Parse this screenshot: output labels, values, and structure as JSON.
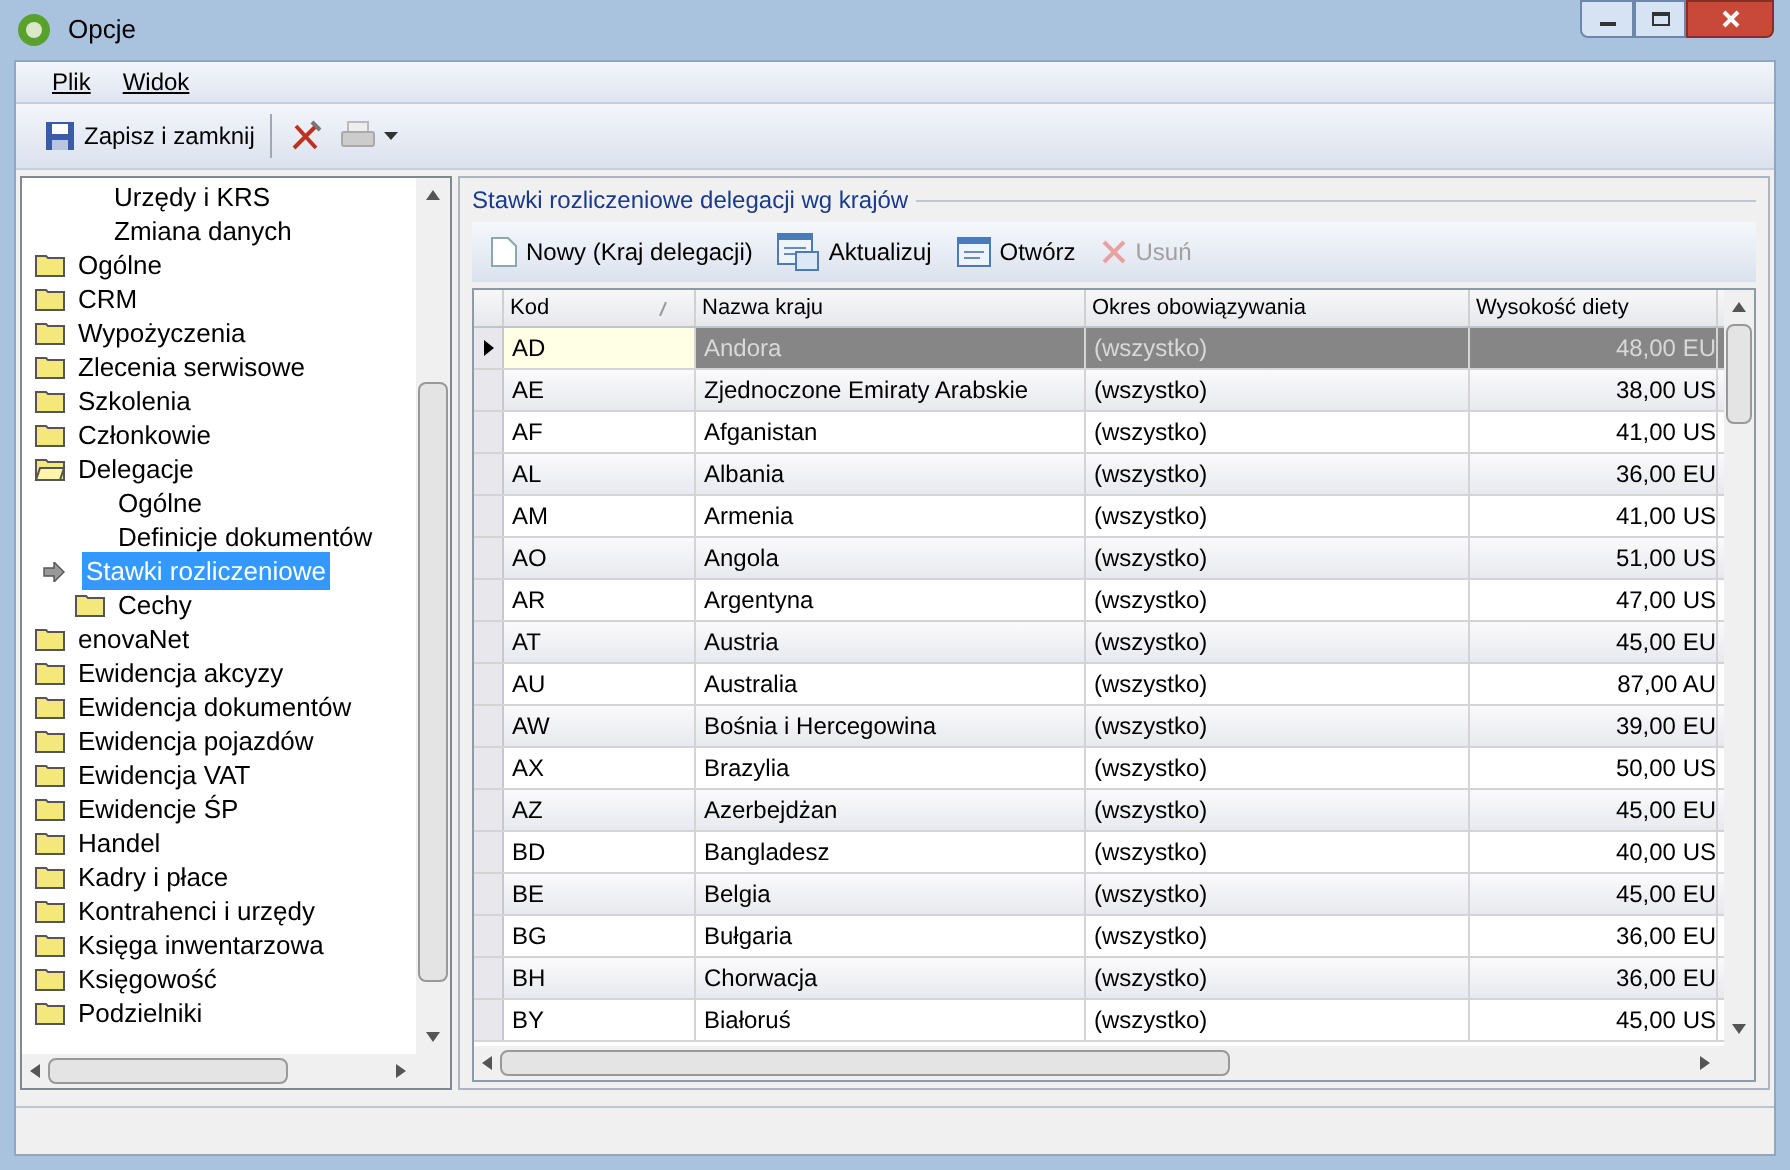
{
  "window": {
    "title": "Opcje"
  },
  "menu": [
    {
      "label": "Plik"
    },
    {
      "label": "Widok"
    }
  ],
  "toolbar": {
    "save_label": "Zapisz i zamknij"
  },
  "tree": {
    "partial_children": [
      {
        "label": "Urzędy i KRS"
      },
      {
        "label": "Zmiana danych"
      }
    ],
    "items": [
      {
        "label": "Ogólne",
        "kind": "folder",
        "expanded": false,
        "selected": false
      },
      {
        "label": "CRM",
        "kind": "folder",
        "expanded": false,
        "selected": false
      },
      {
        "label": "Wypożyczenia",
        "kind": "folder",
        "expanded": false,
        "selected": false
      },
      {
        "label": "Zlecenia serwisowe",
        "kind": "folder",
        "expanded": false,
        "selected": false
      },
      {
        "label": "Szkolenia",
        "kind": "folder",
        "expanded": false,
        "selected": false
      },
      {
        "label": "Członkowie",
        "kind": "folder",
        "expanded": false,
        "selected": false
      },
      {
        "label": "Delegacje",
        "kind": "folder",
        "expanded": true,
        "selected": false,
        "children": [
          {
            "label": "Ogólne",
            "kind": "leaf",
            "selected": false
          },
          {
            "label": "Definicje dokumentów",
            "kind": "leaf",
            "selected": false
          },
          {
            "label": "Stawki rozliczeniowe",
            "kind": "leaf",
            "selected": true
          },
          {
            "label": "Cechy",
            "kind": "folder",
            "expanded": false,
            "selected": false
          }
        ]
      },
      {
        "label": "enovaNet",
        "kind": "folder",
        "expanded": false,
        "selected": false
      },
      {
        "label": "Ewidencja akcyzy",
        "kind": "folder",
        "expanded": false,
        "selected": false
      },
      {
        "label": "Ewidencja dokumentów",
        "kind": "folder",
        "expanded": false,
        "selected": false
      },
      {
        "label": "Ewidencja pojazdów",
        "kind": "folder",
        "expanded": false,
        "selected": false
      },
      {
        "label": "Ewidencja VAT",
        "kind": "folder",
        "expanded": false,
        "selected": false
      },
      {
        "label": "Ewidencje ŚP",
        "kind": "folder",
        "expanded": false,
        "selected": false
      },
      {
        "label": "Handel",
        "kind": "folder",
        "expanded": false,
        "selected": false
      },
      {
        "label": "Kadry i płace",
        "kind": "folder",
        "expanded": false,
        "selected": false
      },
      {
        "label": "Kontrahenci i urzędy",
        "kind": "folder",
        "expanded": false,
        "selected": false
      },
      {
        "label": "Księga inwentarzowa",
        "kind": "folder",
        "expanded": false,
        "selected": false
      },
      {
        "label": "Księgowość",
        "kind": "folder",
        "expanded": false,
        "selected": false
      },
      {
        "label": "Podzielniki",
        "kind": "folder",
        "expanded": false,
        "selected": false
      }
    ]
  },
  "group": {
    "title": "Stawki rozliczeniowe delegacji wg krajów",
    "actions": [
      {
        "label": "Nowy (Kraj delegacji)",
        "kind": "new",
        "disabled": false
      },
      {
        "label": "Aktualizuj",
        "kind": "refresh",
        "disabled": false
      },
      {
        "label": "Otwórz",
        "kind": "open",
        "disabled": false
      },
      {
        "label": "Usuń",
        "kind": "delete",
        "disabled": true
      }
    ]
  },
  "table": {
    "columns": [
      "Kod",
      "Nazwa kraju",
      "Okres obowiązywania",
      "Wysokość diety"
    ],
    "rows": [
      {
        "cells": [
          "AD",
          "Andora",
          "(wszystko)",
          "48,00 EU"
        ],
        "selected": true
      },
      {
        "cells": [
          "AE",
          "Zjednoczone Emiraty Arabskie",
          "(wszystko)",
          "38,00 US"
        ],
        "selected": false
      },
      {
        "cells": [
          "AF",
          "Afganistan",
          "(wszystko)",
          "41,00 US"
        ],
        "selected": false
      },
      {
        "cells": [
          "AL",
          "Albania",
          "(wszystko)",
          "36,00 EU"
        ],
        "selected": false
      },
      {
        "cells": [
          "AM",
          "Armenia",
          "(wszystko)",
          "41,00 US"
        ],
        "selected": false
      },
      {
        "cells": [
          "AO",
          "Angola",
          "(wszystko)",
          "51,00 US"
        ],
        "selected": false
      },
      {
        "cells": [
          "AR",
          "Argentyna",
          "(wszystko)",
          "47,00 US"
        ],
        "selected": false
      },
      {
        "cells": [
          "AT",
          "Austria",
          "(wszystko)",
          "45,00 EU"
        ],
        "selected": false
      },
      {
        "cells": [
          "AU",
          "Australia",
          "(wszystko)",
          "87,00 AU"
        ],
        "selected": false
      },
      {
        "cells": [
          "AW",
          "Bośnia i Hercegowina",
          "(wszystko)",
          "39,00 EU"
        ],
        "selected": false
      },
      {
        "cells": [
          "AX",
          "Brazylia",
          "(wszystko)",
          "50,00 US"
        ],
        "selected": false
      },
      {
        "cells": [
          "AZ",
          "Azerbejdżan",
          "(wszystko)",
          "45,00 EU"
        ],
        "selected": false
      },
      {
        "cells": [
          "BD",
          "Bangladesz",
          "(wszystko)",
          "40,00 US"
        ],
        "selected": false
      },
      {
        "cells": [
          "BE",
          "Belgia",
          "(wszystko)",
          "45,00 EU"
        ],
        "selected": false
      },
      {
        "cells": [
          "BG",
          "Bułgaria",
          "(wszystko)",
          "36,00 EU"
        ],
        "selected": false
      },
      {
        "cells": [
          "BH",
          "Chorwacja",
          "(wszystko)",
          "36,00 EU"
        ],
        "selected": false
      },
      {
        "cells": [
          "BY",
          "Białoruś",
          "(wszystko)",
          "45,00 US"
        ],
        "selected": false
      }
    ]
  }
}
